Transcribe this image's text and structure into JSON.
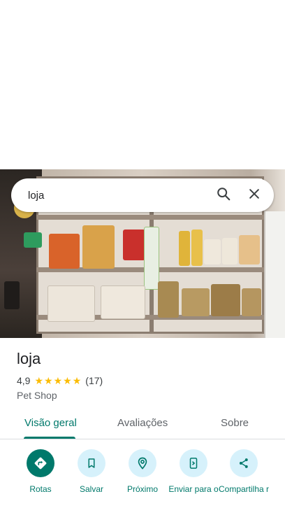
{
  "search": {
    "query": "loja"
  },
  "place": {
    "name": "loja",
    "rating": "4,9",
    "rating_stars": 5,
    "reviews_count": "(17)",
    "category": "Pet Shop"
  },
  "tabs": [
    {
      "label": "Visão geral",
      "active": true
    },
    {
      "label": "Avaliações",
      "active": false
    },
    {
      "label": "Sobre",
      "active": false
    }
  ],
  "actions": [
    {
      "label": "Rotas",
      "icon": "directions-icon"
    },
    {
      "label": "Salvar",
      "icon": "bookmark-icon"
    },
    {
      "label": "Próximo",
      "icon": "nearby-icon"
    },
    {
      "label": "Enviar para o",
      "icon": "send-to-phone-icon"
    },
    {
      "label": "Compartilha r",
      "icon": "share-icon"
    }
  ],
  "colors": {
    "accent": "#00796b",
    "action_bg": "#d6f1fb",
    "star": "#fbbc04"
  }
}
